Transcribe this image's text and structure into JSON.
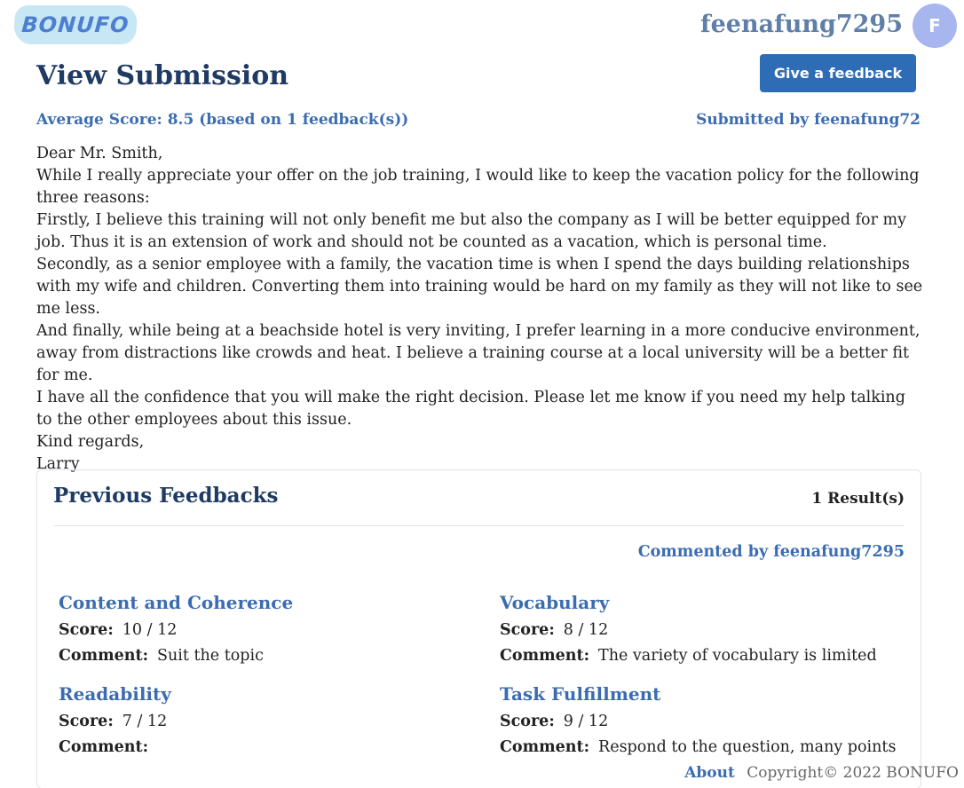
{
  "header": {
    "logo_text": "BONUFO",
    "username": "feenafung7295",
    "avatar_initial": "F"
  },
  "page": {
    "title": "View Submission",
    "feedback_button": "Give a feedback",
    "average_score": "Average Score: 8.5 (based on 1 feedback(s))",
    "submitted_by": "Submitted by feenafung72"
  },
  "letter": [
    "Dear Mr. Smith,",
    "While I really appreciate your offer on the job training, I would like to keep the vacation policy for the following three reasons:",
    "Firstly, I believe this training will not only benefit me but also the company as I will be better equipped for my job. Thus it is an extension of work and should not be counted as a vacation, which is personal time.",
    "Secondly, as a senior employee with a family, the vacation time is when I spend the days building relationships with my wife and children. Converting them into training would be hard on my family as they will not like to see me less.",
    "And finally, while being at a beachside hotel is very inviting, I prefer learning in a more conducive environment, away from distractions like crowds and heat. I believe a training course at a local university will be a better fit for me.",
    "I have all the confidence that you will make the right decision. Please let me know if you need my help talking to the other employees about this issue.",
    "Kind regards,",
    "Larry"
  ],
  "feedbacks": {
    "title": "Previous Feedbacks",
    "result_count": "1 Result(s)",
    "commented_by": "Commented by feenafung7295",
    "score_label": "Score:",
    "comment_label": "Comment:",
    "criteria": [
      {
        "name": "Content and Coherence",
        "score": "10 / 12",
        "comment": "Suit the topic"
      },
      {
        "name": "Vocabulary",
        "score": "8 / 12",
        "comment": "The variety of vocabulary is limited"
      },
      {
        "name": "Readability",
        "score": "7 / 12",
        "comment": ""
      },
      {
        "name": "Task Fulfillment",
        "score": "9 / 12",
        "comment": "Respond to the question, many points"
      }
    ]
  },
  "footer": {
    "about": "About",
    "copyright": "Copyright© 2022 BONUFO"
  }
}
